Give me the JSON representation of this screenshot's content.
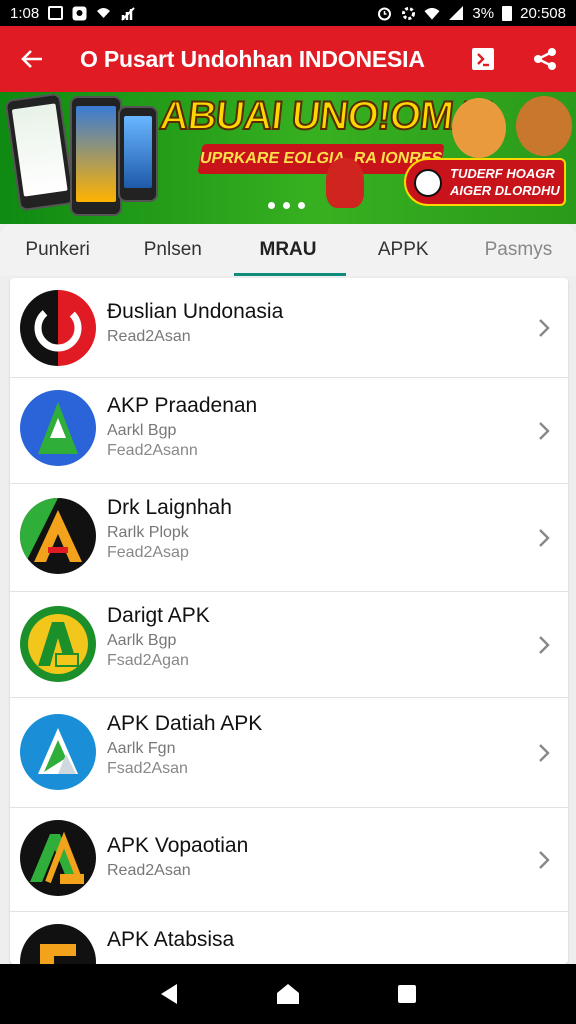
{
  "status_bar": {
    "time": "1:08",
    "battery_pct": "3%",
    "clock_right": "20:508",
    "icons": [
      "calendar-box-icon",
      "notification-icon",
      "wifi-calling-icon",
      "no-signal-icon",
      "alarm-icon",
      "settings-icon",
      "wifi-icon",
      "signal-icon",
      "battery-icon"
    ]
  },
  "app_bar": {
    "title": "O Pusart Undohhan  INDONESIA",
    "back_icon": "arrow-back-icon",
    "actions": [
      "code-icon",
      "share-icon"
    ],
    "color": "#e01b24"
  },
  "banner": {
    "headline": "ABUAI UNO!OMA!",
    "subline": "UPRKARE EOLGIA. RA IONRES",
    "cta_line1": "TUDERF HOAGR",
    "cta_line2": "AIGER DLORDHU",
    "page_count": 3
  },
  "tabs": [
    {
      "label": "Punkeri",
      "active": false
    },
    {
      "label": "Pnlsen",
      "active": false
    },
    {
      "label": "MRAU",
      "active": true
    },
    {
      "label": "APPK",
      "active": false
    },
    {
      "label": "Pasmys",
      "active": false
    }
  ],
  "apps": [
    {
      "title": "Ɖuslian Undonasia",
      "sub": "Read2Asan",
      "sub2": ""
    },
    {
      "title": "AKP Praadenan",
      "sub": "Aarkl Bgp",
      "sub2": "Fead2Asann"
    },
    {
      "title": "Drk Laignhah",
      "sub": "Rarlk Plopk",
      "sub2": "Fead2Asap"
    },
    {
      "title": "Darigt APK",
      "sub": "Aarlk Bgp",
      "sub2": "Fsad2Agan"
    },
    {
      "title": "APK Datiah APK",
      "sub": "Aarlk Fgn",
      "sub2": "Fsad2Asan"
    },
    {
      "title": "APK Vopaotian",
      "sub": "Read2Asan",
      "sub2": ""
    },
    {
      "title": "APK Atabsisa",
      "sub": "",
      "sub2": ""
    }
  ],
  "colors": {
    "accent_red": "#e01b24",
    "tab_indicator": "#0f8c7a",
    "banner_green": "#37b020"
  }
}
